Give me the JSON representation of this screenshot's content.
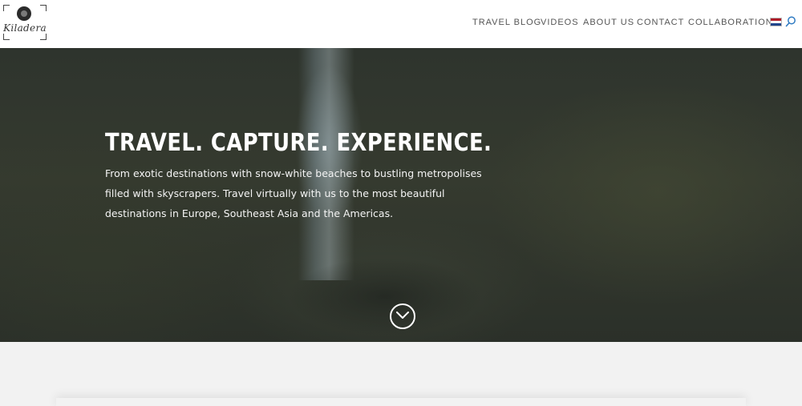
{
  "brand": {
    "name": "Kiladera",
    "icon": "camera-lens-icon"
  },
  "nav": {
    "items": [
      {
        "label": "TRAVEL BLOG"
      },
      {
        "label": "VIDEOS"
      },
      {
        "label": "ABOUT US"
      },
      {
        "label": "CONTACT"
      },
      {
        "label": "COLLABORATION"
      }
    ],
    "language_icon": "netherlands-flag-icon",
    "search_icon": "search-icon"
  },
  "hero": {
    "title": "TRAVEL. CAPTURE. EXPERIENCE.",
    "text": "From exotic destinations with snow-white beaches to bustling metropolises filled with skyscrapers. Travel virtually with us to the most beautiful destinations in Europe, Southeast Asia and the Americas.",
    "scroll_icon": "chevron-down-circle-icon"
  },
  "colors": {
    "flag_red": "#ae1c28",
    "flag_white": "#ffffff",
    "flag_blue": "#21468b",
    "search_accent": "#2e7ac2",
    "nav_text": "#555555"
  }
}
